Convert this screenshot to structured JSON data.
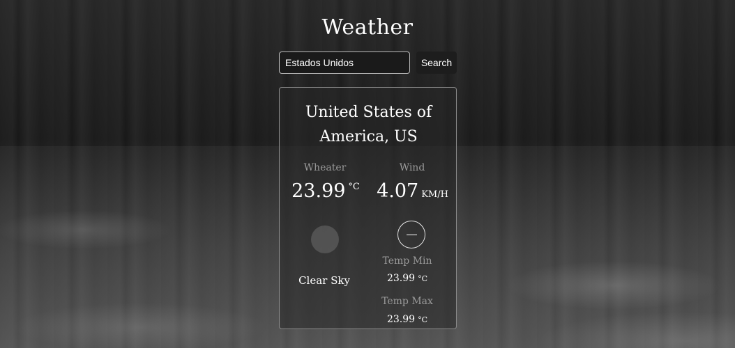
{
  "app": {
    "title": "Weather"
  },
  "search": {
    "value": "Estados Unidos",
    "button_label": "Search"
  },
  "weather": {
    "location": [
      "United States of",
      "America, US"
    ],
    "weather_label": "Wheater",
    "wind_label": "Wind",
    "temperature": "23.99",
    "temperature_unit": "°C",
    "wind_speed": "4.07",
    "wind_unit": "KM/H",
    "description": "Clear Sky",
    "temp_min_label": "Temp Min",
    "temp_min": "23.99",
    "temp_max_label": "Temp Max",
    "temp_max": "23.99"
  },
  "icons": {
    "weather": "sun-icon",
    "wind": "wind-direction-icon"
  }
}
